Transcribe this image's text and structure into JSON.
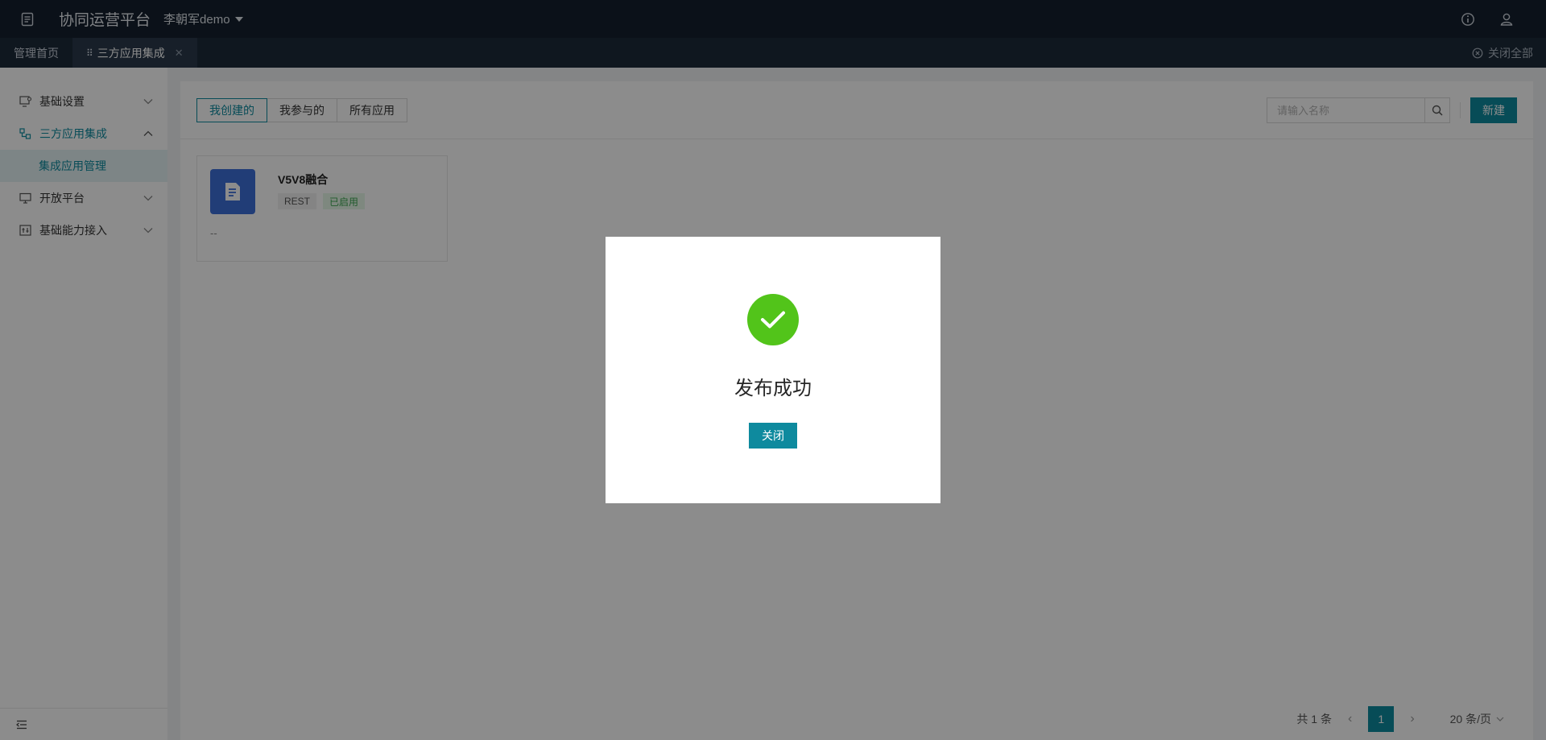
{
  "header": {
    "app_title": "协同运营平台",
    "user_name": "李朝军demo"
  },
  "tabs": {
    "items": [
      {
        "label": "管理首页",
        "active": false
      },
      {
        "label": "三方应用集成",
        "active": true
      }
    ],
    "close_all_label": "关闭全部"
  },
  "sidebar": {
    "items": [
      {
        "label": "基础设置",
        "expanded": false
      },
      {
        "label": "三方应用集成",
        "expanded": true
      },
      {
        "label": "开放平台",
        "expanded": false
      },
      {
        "label": "基础能力接入",
        "expanded": false
      }
    ],
    "sub_items": [
      {
        "label": "集成应用管理",
        "selected": true
      }
    ]
  },
  "toolbar": {
    "filters": [
      {
        "label": "我创建的",
        "active": true
      },
      {
        "label": "我参与的",
        "active": false
      },
      {
        "label": "所有应用",
        "active": false
      }
    ],
    "search_placeholder": "请输入名称",
    "new_label": "新建"
  },
  "apps": [
    {
      "name": "V5V8融合",
      "protocol": "REST",
      "status": "已启用",
      "description": "--"
    }
  ],
  "pagination": {
    "total_label": "共 1 条",
    "current_page": "1",
    "page_size_label": "20 条/页"
  },
  "modal": {
    "message": "发布成功",
    "close_label": "关闭"
  },
  "colors": {
    "accent": "#0e8a9e",
    "success": "#52c41a",
    "topbar": "#14202e",
    "app_icon": "#3d6fd9"
  },
  "icons": [
    "document-icon",
    "info-icon",
    "user-icon",
    "caret-down-icon",
    "grip-icon",
    "close-icon",
    "settings-icon",
    "integration-icon",
    "monitor-icon",
    "capability-icon",
    "chevron-down-icon",
    "chevron-up-icon",
    "search-icon",
    "collapse-menu-icon",
    "check-icon",
    "chevron-left-icon",
    "chevron-right-icon"
  ]
}
